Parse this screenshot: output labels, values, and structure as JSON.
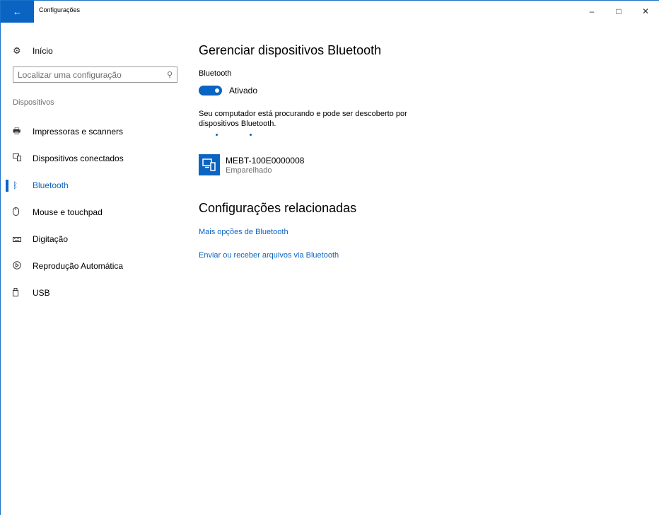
{
  "window": {
    "title": "Configurações",
    "back_icon": "arrow-left",
    "controls": {
      "minimize": "–",
      "maximize": "□",
      "close": "✕"
    }
  },
  "sidebar": {
    "home_label": "Início",
    "search_placeholder": "Localizar uma configuração",
    "section_label": "Dispositivos",
    "items": [
      {
        "label": "Impressoras e scanners",
        "icon": "printer-icon",
        "active": false
      },
      {
        "label": "Dispositivos conectados",
        "icon": "devices-icon",
        "active": false
      },
      {
        "label": "Bluetooth",
        "icon": "bluetooth-icon",
        "active": true
      },
      {
        "label": "Mouse e touchpad",
        "icon": "mouse-icon",
        "active": false
      },
      {
        "label": "Digitação",
        "icon": "keyboard-icon",
        "active": false
      },
      {
        "label": "Reprodução Automática",
        "icon": "autoplay-icon",
        "active": false
      },
      {
        "label": "USB",
        "icon": "usb-icon",
        "active": false
      }
    ]
  },
  "main": {
    "title": "Gerenciar dispositivos Bluetooth",
    "bluetooth_label": "Bluetooth",
    "toggle_state": "Ativado",
    "description": "Seu computador está procurando e pode ser descoberto por dispositivos Bluetooth.",
    "device": {
      "name": "MEBT-100E0000008",
      "status": "Emparelhado"
    },
    "related_title": "Configurações relacionadas",
    "links": [
      "Mais opções de Bluetooth",
      "Enviar ou receber arquivos via Bluetooth"
    ]
  },
  "colors": {
    "accent": "#0a64c2",
    "secondary_text": "#6e6e6e"
  }
}
